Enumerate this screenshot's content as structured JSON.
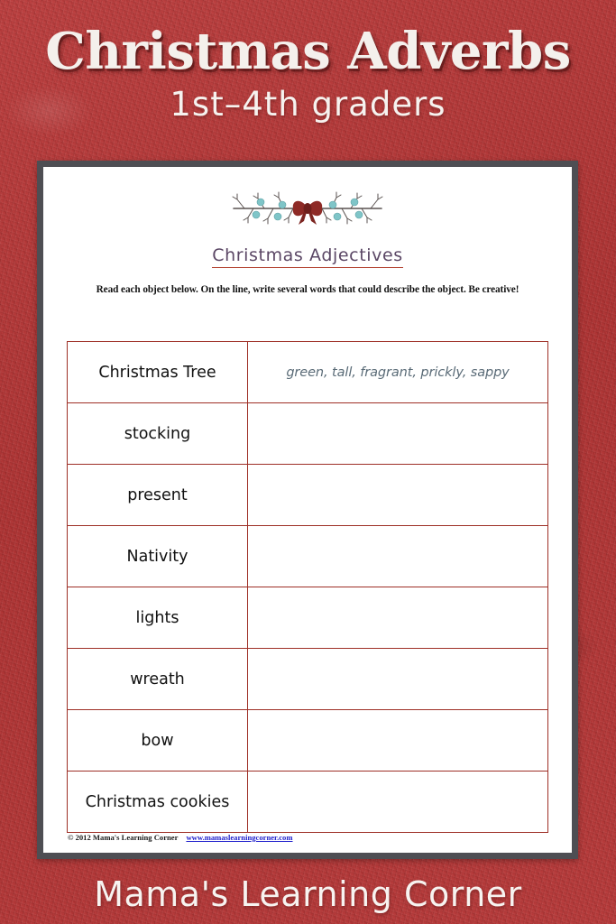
{
  "poster": {
    "main_title": "Christmas Adverbs",
    "subtitle": "1st–4th graders",
    "brand": "Mama's Learning Corner",
    "background_color": "#b13838",
    "title_color": "#f4f0ec"
  },
  "worksheet": {
    "frame_color": "#4e4e53",
    "paper_color": "#ffffff",
    "ornament": {
      "icon": "twig-bow-divider-icon",
      "bow_color": "#8e2a26",
      "berry_color": "#7fc5c8",
      "branch_color": "#5a5250"
    },
    "title": "Christmas Adjectives",
    "title_color": "#5b4765",
    "title_underline_color": "#b2402f",
    "instructions": "Read each object below.  On the line, write several words that could describe the object.  Be creative!",
    "table": {
      "border_color": "#9e2f26",
      "answer_text_color": "#5a6b77",
      "rows": [
        {
          "term": "Christmas Tree",
          "answer": "green, tall, fragrant, prickly, sappy"
        },
        {
          "term": "stocking",
          "answer": ""
        },
        {
          "term": "present",
          "answer": ""
        },
        {
          "term": "Nativity",
          "answer": ""
        },
        {
          "term": "lights",
          "answer": ""
        },
        {
          "term": "wreath",
          "answer": ""
        },
        {
          "term": "bow",
          "answer": ""
        },
        {
          "term": "Christmas cookies",
          "answer": ""
        }
      ]
    },
    "footer": {
      "copyright": "© 2012 Mama's Learning Corner",
      "link": "www.mamaslearningcorner.com",
      "link_color": "#2020cc"
    }
  }
}
